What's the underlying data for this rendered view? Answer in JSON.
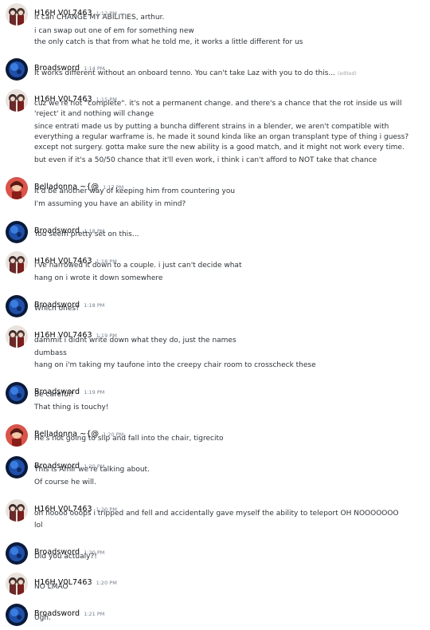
{
  "users": {
    "h16h": "H16H V0L7463",
    "broadsword": "Broadsword",
    "belladonna": "Belladonna ~{@"
  },
  "icons": {
    "h16h": "avatar-two-figures-icon",
    "broadsword": "avatar-blue-planet-icon",
    "belladonna": "avatar-red-character-icon"
  },
  "colors": {
    "text": "#2e3338",
    "username": "#060607",
    "timestamp": "#747f8d"
  },
  "messages": [
    {
      "user": "H16H V0L7463",
      "time": "1:12 PM",
      "lines": [
        "it can CHANGE MY ABILITIES, arthur.",
        "i can swap out one of em for something new",
        "the only catch is that from what he told me, it works a little different for us"
      ]
    },
    {
      "user": "Broadsword",
      "time": "1:14 PM",
      "lines": [
        "It works different without an onboard tenno. You can't take Laz with you to do this..."
      ],
      "edited": "(edited)"
    },
    {
      "user": "H16H V0L7463",
      "time": "1:15 PM",
      "lines": [
        "cuz we're not \"complete\". it's not a permanent change. and there's a chance that the rot inside us will 'reject' it and nothing will change",
        "since entrati made us by putting a buncha different strains in a blender, we aren't compatible with everything a regular warframe is. he made it sound kinda like an organ transplant type of thing i guess? except not surgery. gotta make sure the new ability is a good match, and it might not work every time.",
        "but even if it's a 50/50 chance that it'll even work, i think i can't afford to NOT take that chance"
      ]
    },
    {
      "user": "Belladonna ~{@",
      "time": "1:17 PM",
      "lines": [
        "It'd be another way of keeping him from countering you",
        "I'm assuming you have an ability in mind?"
      ]
    },
    {
      "user": "Broadsword",
      "time": "1:18 PM",
      "lines": [
        "You seem pretty set on this..."
      ]
    },
    {
      "user": "H16H V0L7463",
      "time": "1:18 PM",
      "lines": [
        "i've narrowed it down to a couple. i just can't decide what",
        "hang on i wrote it down somewhere"
      ]
    },
    {
      "user": "Broadsword",
      "time": "1:18 PM",
      "lines": [
        "Which ones?"
      ]
    },
    {
      "user": "H16H V0L7463",
      "time": "1:19 PM",
      "lines": [
        "dammit i didnt write down what they do, just the names",
        "dumbass",
        "hang on i'm taking my taufone into the creepy chair room to crosscheck these"
      ]
    },
    {
      "user": "Broadsword",
      "time": "1:19 PM",
      "lines": [
        "Be careful!",
        "That thing is touchy!"
      ]
    },
    {
      "user": "Belladonna ~{@",
      "time": "1:20 PM",
      "lines": [
        "He's not going to slip and fall into the chair, tigrecito"
      ]
    },
    {
      "user": "Broadsword",
      "time": "1:20 PM",
      "lines": [
        "This is Amir we're talking about.",
        "Of course he will."
      ]
    },
    {
      "user": "H16H V0L7463",
      "time": "1:20 PM",
      "lines": [
        "oh noooo ooops i tripped and fell and accidentally gave myself the ability to teleport OH NOOOOOOO",
        "lol"
      ]
    },
    {
      "user": "Broadsword",
      "time": "1:20 PM",
      "lines": [
        "Did you actualy?!"
      ]
    },
    {
      "user": "H16H V0L7463",
      "time": "1:20 PM",
      "lines": [
        "NO LMAO"
      ]
    },
    {
      "user": "Broadsword",
      "time": "1:21 PM",
      "lines": [
        "Ugh."
      ]
    }
  ]
}
